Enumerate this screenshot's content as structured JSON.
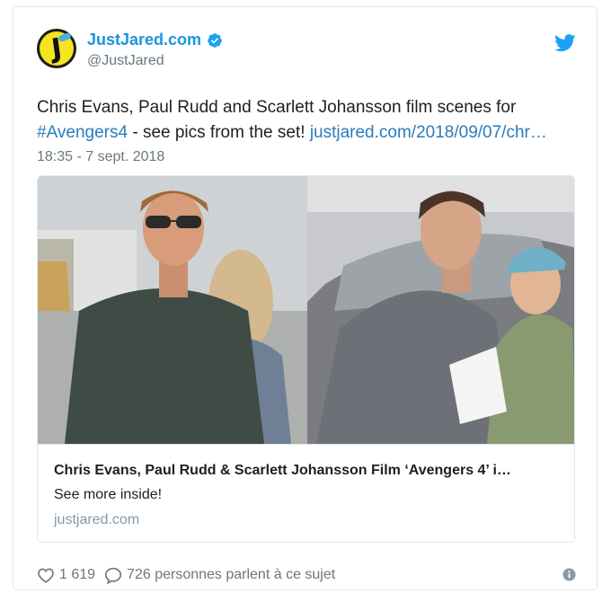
{
  "author": {
    "display_name": "JustJared.com",
    "handle": "@JustJared",
    "avatar_letter": "J",
    "verified": true
  },
  "tweet": {
    "text_part1": "Chris Evans, Paul Rudd and Scarlett Johansson film scenes for ",
    "hashtag": "#Avengers4",
    "text_part2": " - see pics from the set! ",
    "link": "justjared.com/2018/09/07/chr…",
    "timestamp": "18:35 - 7 sept. 2018"
  },
  "link_card": {
    "title": "Chris Evans, Paul Rudd & Scarlett Johansson Film ‘Avengers 4’ i…",
    "description": "See more inside!",
    "domain": "justjared.com"
  },
  "footer": {
    "likes": "1 619",
    "conversation": "726 personnes parlent à ce sujet"
  },
  "icons": {
    "bird": "twitter-bird-icon",
    "heart": "heart-icon",
    "bubble": "speech-bubble-icon",
    "info": "info-icon"
  },
  "colors": {
    "accent": "#1b95e0",
    "link": "#2b7bb9",
    "muted": "#697882"
  }
}
